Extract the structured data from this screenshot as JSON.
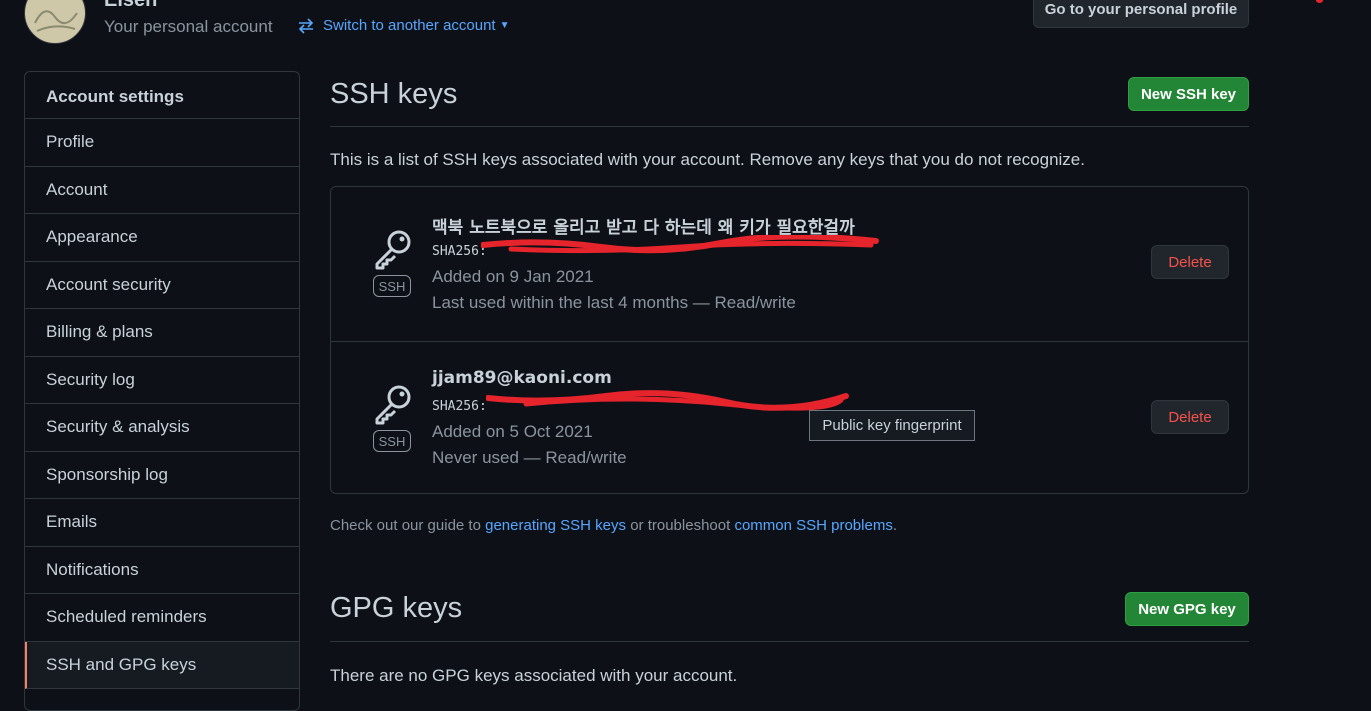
{
  "header": {
    "username": "Eisen",
    "subtitle": "Your personal account",
    "switch_label": "Switch to another account",
    "profile_button": "Go to your personal profile"
  },
  "sidebar": {
    "heading": "Account settings",
    "items": [
      {
        "label": "Profile"
      },
      {
        "label": "Account"
      },
      {
        "label": "Appearance"
      },
      {
        "label": "Account security"
      },
      {
        "label": "Billing & plans"
      },
      {
        "label": "Security log"
      },
      {
        "label": "Security & analysis"
      },
      {
        "label": "Sponsorship log"
      },
      {
        "label": "Emails"
      },
      {
        "label": "Notifications"
      },
      {
        "label": "Scheduled reminders"
      },
      {
        "label": "SSH and GPG keys"
      }
    ],
    "active": "SSH and GPG keys"
  },
  "ssh": {
    "title": "SSH keys",
    "new_button": "New SSH key",
    "intro": "This is a list of SSH keys associated with your account. Remove any keys that you do not recognize.",
    "badge": "SSH",
    "delete_label": "Delete",
    "keys": [
      {
        "title": "맥북 노트북으로 올리고 받고 다 하는데 왜 키가 필요한걸까",
        "fingerprint": "SHA256:",
        "added": "Added on 9 Jan 2021",
        "last_used": "Last used within the last 4 months — Read/write"
      },
      {
        "title": "jjam89@kaoni.com",
        "fingerprint": "SHA256:",
        "added": "Added on 5 Oct 2021",
        "last_used": "Never used — Read/write"
      }
    ],
    "tooltip": "Public key fingerprint",
    "guide": {
      "prefix": "Check out our guide to ",
      "link1": "generating SSH keys",
      "middle": " or troubleshoot ",
      "link2": "common SSH problems",
      "suffix": "."
    }
  },
  "gpg": {
    "title": "GPG keys",
    "new_button": "New GPG key",
    "empty": "There are no GPG keys associated with your account."
  },
  "colors": {
    "background": "#0d1117",
    "border": "#30363d",
    "text": "#c9d1d9",
    "muted": "#8b949e",
    "link": "#58a6ff",
    "primary": "#238636",
    "danger": "#f85149",
    "active_marker": "#f78166",
    "redaction": "#e5242b"
  },
  "icons": {
    "switch": "arrow-switch-icon",
    "key": "key-icon",
    "caret": "caret-down-icon"
  }
}
